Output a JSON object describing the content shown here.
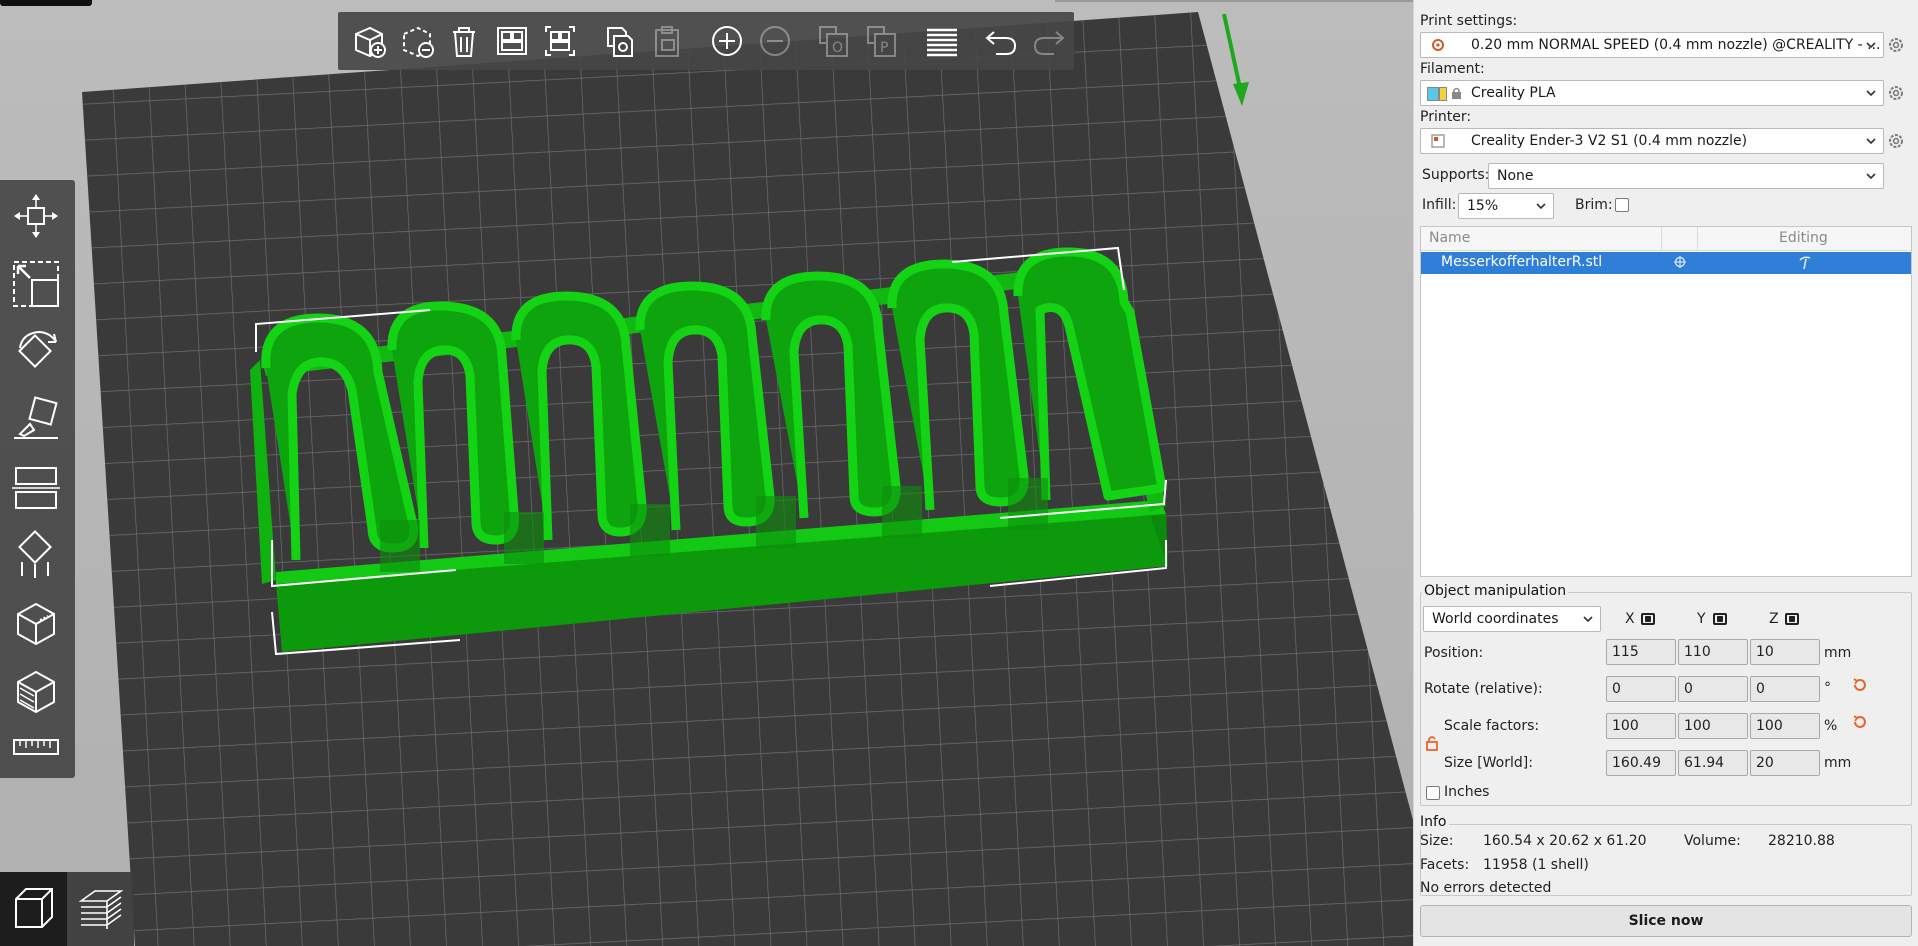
{
  "print_settings": {
    "label": "Print settings:",
    "value": "0.20 mm NORMAL SPEED (0.4 mm nozzle) @CREALITY - ..."
  },
  "filament": {
    "label": "Filament:",
    "value": "Creality PLA",
    "swatch_colors": [
      "#5bc7e8",
      "#f2d33c"
    ]
  },
  "printer": {
    "label": "Printer:",
    "value": "Creality Ender-3 V2 S1 (0.4 mm nozzle)"
  },
  "supports": {
    "label": "Supports:",
    "value": "None"
  },
  "infill": {
    "label": "Infill:",
    "value": "15%"
  },
  "brim": {
    "label": "Brim:",
    "checked": false
  },
  "object_list": {
    "columns": {
      "name": "Name",
      "editing": "Editing"
    },
    "rows": [
      {
        "name": "MesserkofferhalterR.stl"
      }
    ]
  },
  "object_manipulation": {
    "title": "Object manipulation",
    "coordinate_system": "World coordinates",
    "axes": {
      "x": "X",
      "y": "Y",
      "z": "Z"
    },
    "position": {
      "label": "Position:",
      "x": "115",
      "y": "110",
      "z": "10",
      "unit": "mm"
    },
    "rotate": {
      "label": "Rotate (relative):",
      "x": "0",
      "y": "0",
      "z": "0",
      "unit": "°"
    },
    "scale": {
      "label": "Scale factors:",
      "x": "100",
      "y": "100",
      "z": "100",
      "unit": "%"
    },
    "size": {
      "label": "Size [World]:",
      "x": "160.49",
      "y": "61.94",
      "z": "20",
      "unit": "mm"
    },
    "inches": {
      "label": "Inches",
      "checked": false
    }
  },
  "info": {
    "title": "Info",
    "size_label": "Size:",
    "size_value": "160.54 x 20.62 x 61.20",
    "volume_label": "Volume:",
    "volume_value": "28210.88",
    "facets_label": "Facets:",
    "facets_value": "11958 (1 shell)",
    "errors": "No errors detected"
  },
  "slice_button": "Slice now",
  "colors": {
    "model_green": "#12c212",
    "model_dark": "#0a8f0a",
    "bed_dark": "#3a3a3a",
    "selection_blue": "#2f7fd9",
    "accent_orange": "#e8662a"
  },
  "top_toolbar": [
    "add-icon",
    "delete-icon",
    "delete-all-icon",
    "arrange-icon",
    "arrange-selection-icon",
    "copy-icon",
    "paste-icon",
    "add-instance-icon",
    "remove-instance-icon",
    "split-objects-icon",
    "split-parts-icon",
    "layers-editing-icon",
    "undo-icon",
    "redo-icon"
  ],
  "left_toolbar": [
    "move-icon",
    "scale-icon",
    "rotate-icon",
    "place-on-face-icon",
    "cut-icon",
    "supports-paint-icon",
    "seam-paint-icon",
    "mmu-paint-icon",
    "measure-icon"
  ],
  "view_toolbar": [
    "3d-view-icon",
    "preview-icon"
  ]
}
